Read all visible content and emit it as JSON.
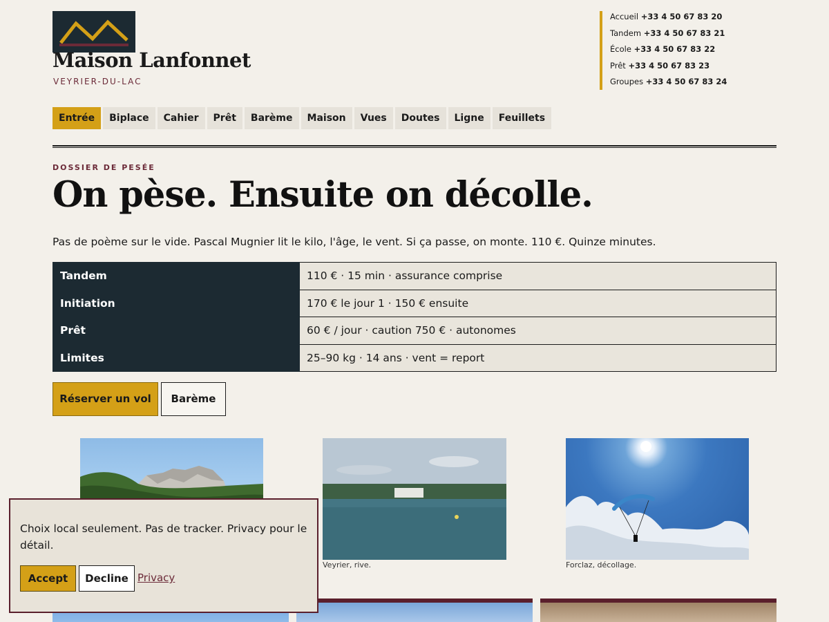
{
  "site": {
    "title": "Maison Lanfonnet",
    "subtitle": "VEYRIER-DU-LAC",
    "colors": {
      "gold": "#d4a017",
      "navy": "#1c2a32",
      "burgundy": "#5a1f2c",
      "background": "#f3f0ea"
    }
  },
  "contacts": [
    {
      "label": "Accueil",
      "number": "+33 4 50 67 83 20"
    },
    {
      "label": "Tandem",
      "number": "+33 4 50 67 83 21"
    },
    {
      "label": "École",
      "number": "+33 4 50 67 83 22"
    },
    {
      "label": "Prêt",
      "number": "+33 4 50 67 83 23"
    },
    {
      "label": "Groupes",
      "number": "+33 4 50 67 83 24"
    }
  ],
  "nav": {
    "active": "Entrée",
    "items": [
      "Entrée",
      "Biplace",
      "Cahier",
      "Prêt",
      "Barème",
      "Maison",
      "Vues",
      "Doutes",
      "Ligne",
      "Feuillets"
    ]
  },
  "hero": {
    "eyebrow": "DOSSIER DE PESÉE",
    "headline": "On pèse. Ensuite on décolle.",
    "lede": "Pas de poème sur le vide. Pascal Mugnier lit le kilo, l'âge, le vent. Si ça passe, on monte. 110 €. Quinze minutes."
  },
  "pricing": [
    {
      "key": "Tandem",
      "value": "110 € · 15 min · assurance comprise"
    },
    {
      "key": "Initiation",
      "value": "170 € le jour 1 · 150 € ensuite"
    },
    {
      "key": "Prêt",
      "value": "60 € / jour · caution 750 € · autonomes"
    },
    {
      "key": "Limites",
      "value": "25–90 kg · 14 ans · vent = report"
    }
  ],
  "actions": {
    "primary": "Réserver un vol",
    "secondary": "Barème"
  },
  "gallery": [
    {
      "caption": ""
    },
    {
      "caption": "Veyrier, rive."
    },
    {
      "caption": "Forclaz, décollage."
    }
  ],
  "cookie": {
    "text": "Choix local seulement. Pas de tracker. Privacy pour le détail.",
    "accept": "Accept",
    "decline": "Decline",
    "privacy": "Privacy"
  }
}
